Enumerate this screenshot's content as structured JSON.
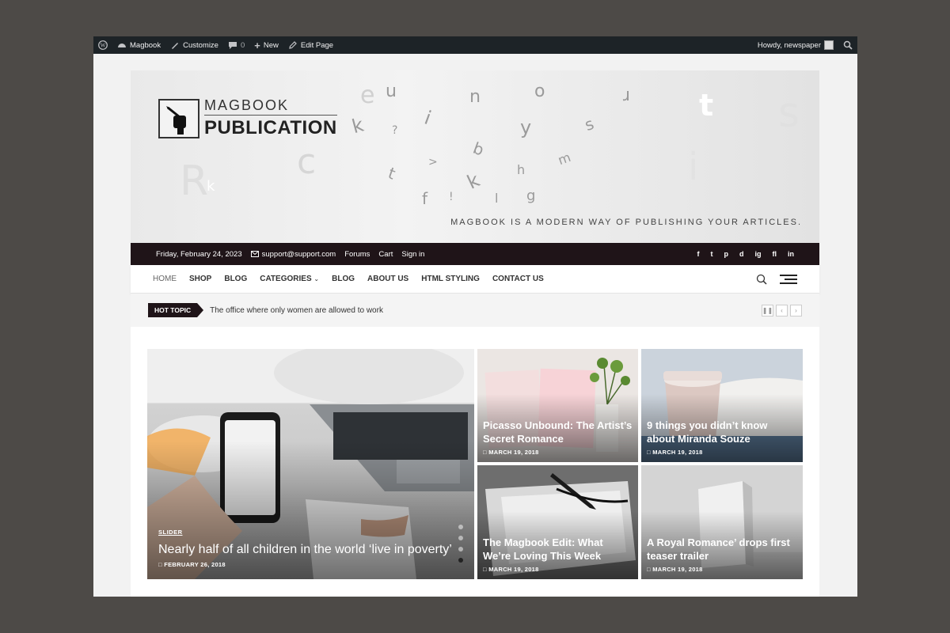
{
  "adminbar": {
    "site_name": "Magbook",
    "customize": "Customize",
    "comments": "0",
    "new": "New",
    "edit_page": "Edit Page",
    "howdy": "Howdy, newspaper"
  },
  "header": {
    "logo_line1": "MAGBOOK",
    "logo_line2": "PUBLICATION",
    "tagline": "MAGBOOK IS A MODERN WAY OF PUBLISHING YOUR ARTICLES."
  },
  "topbar": {
    "date": "Friday, February 24, 2023",
    "email": "support@support.com",
    "links": [
      "Forums",
      "Cart",
      "Sign in"
    ],
    "social": [
      "f",
      "t",
      "p",
      "d",
      "ig",
      "fl",
      "in"
    ]
  },
  "nav": {
    "items": [
      "HOME",
      "SHOP",
      "BLOG",
      "CATEGORIES",
      "BLOG",
      "ABOUT US",
      "HTML STYLING",
      "CONTACT US"
    ]
  },
  "hot_topic": {
    "badge": "HOT TOPIC",
    "text": "The office where only women are allowed to work"
  },
  "featured": {
    "tag": "SLIDER",
    "title": "Nearly half of all children in the world ‘live in poverty’",
    "date": "FEBRUARY 26, 2018"
  },
  "posts": [
    {
      "title": "Picasso Unbound: The Artist’s Secret Romance",
      "date": "MARCH 19, 2018"
    },
    {
      "title": "9 things you didn’t know about Miranda Souze",
      "date": "MARCH 19, 2018"
    },
    {
      "title": "The Magbook Edit: What We’re Loving This Week",
      "date": "MARCH 19, 2018"
    },
    {
      "title": "A Royal Romance’ drops first teaser trailer",
      "date": "MARCH 19, 2018"
    }
  ],
  "colors": {
    "admin_bg": "#1d2327",
    "topbar_bg": "#1f1418",
    "page_bg": "#4d4a47"
  }
}
